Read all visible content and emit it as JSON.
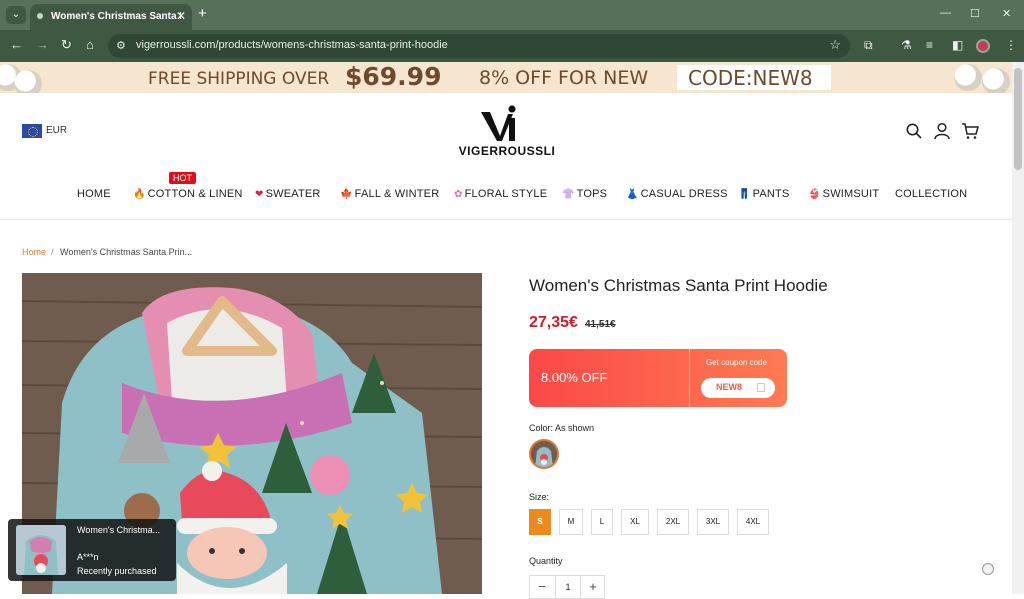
{
  "browser": {
    "tab_title": "Women's Christmas Santa Prin",
    "url": "vigerroussli.com/products/womens-christmas-santa-print-hoodie",
    "icons": [
      "tab-list-icon",
      "close-icon",
      "new-tab-icon",
      "minimize-icon",
      "maximize-icon",
      "window-close-icon",
      "back-icon",
      "forward-icon",
      "reload-icon",
      "home-icon",
      "site-info-icon",
      "star-icon",
      "extensions-icon",
      "labs-icon",
      "media-icon",
      "side-panel-icon",
      "profile-icon",
      "more-icon"
    ],
    "colors": {
      "frame": "#56705a",
      "toolbar": "#3e5842"
    }
  },
  "banner": {
    "shipping": "FREE SHIPPING OVER",
    "amount": "$69.99",
    "discount": "8% OFF FOR NEW",
    "code": "CODE:NEW8"
  },
  "header": {
    "currency": "EUR",
    "logo_text": "VIGERROUSSLI",
    "icons": [
      "flag-icon",
      "search-icon",
      "account-icon",
      "cart-icon"
    ]
  },
  "menu": {
    "hot_badge": "HOT",
    "items": [
      {
        "label": "HOME",
        "icon": ""
      },
      {
        "label": "COTTON & LINEN",
        "icon": "flame"
      },
      {
        "label": "SWEATER",
        "icon": "heart"
      },
      {
        "label": "FALL & WINTER",
        "icon": "maple-leaf"
      },
      {
        "label": "FLORAL STYLE",
        "icon": "flower"
      },
      {
        "label": "TOPS",
        "icon": "shirt"
      },
      {
        "label": "CASUAL DRESS",
        "icon": "dress"
      },
      {
        "label": "PANTS",
        "icon": "jeans"
      },
      {
        "label": "SWIMSUIT",
        "icon": "swimsuit"
      },
      {
        "label": "COLLECTION",
        "icon": ""
      }
    ]
  },
  "breadcrumb": {
    "home": "Home",
    "separator": "/",
    "current": "Women's Christmas Santa Prin..."
  },
  "product": {
    "title": "Women's Christmas Santa Print Hoodie",
    "price": "27,35€",
    "old_price": "41,51€",
    "coupon": {
      "off": "8.00% OFF",
      "get_label": "Get coupon code",
      "code": "NEW8"
    },
    "color_label": "Color: As shown",
    "size_label": "Size:",
    "sizes": [
      "S",
      "M",
      "L",
      "XL",
      "2XL",
      "3XL",
      "4XL"
    ],
    "selected_size": "S",
    "quantity_label": "Quantity",
    "quantity": "1",
    "qty_minus": "−",
    "qty_plus": "+"
  },
  "toast": {
    "product": "Women's Christma...",
    "buyer": "A***n",
    "status": "Recently purchased"
  },
  "colors": {
    "accent_orange": "#ea8a1f",
    "price_red": "#d31b28",
    "coupon_start": "#fb4847",
    "coupon_end": "#ff7b52",
    "banner_bg": "#f6e6cf",
    "banner_text": "#6d4a2d"
  }
}
